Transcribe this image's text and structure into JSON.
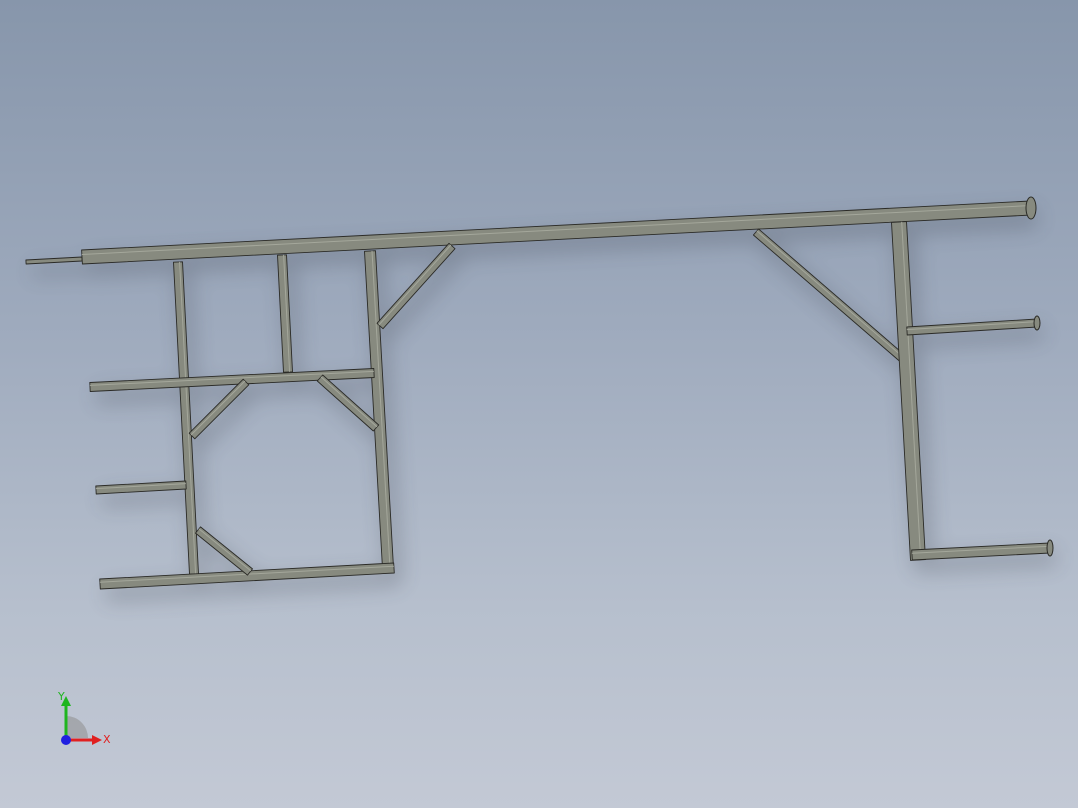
{
  "viewport": {
    "background_top": "#8796ab",
    "background_bottom": "#c3c9d5"
  },
  "model": {
    "part": "steel-tube-frame",
    "beam_color": "#878a7f",
    "beam_edge_color": "#2a2a26"
  },
  "triad": {
    "x_label": "X",
    "y_label": "Y",
    "x_color": "#e02020",
    "y_color": "#1fb51f",
    "z_color": "#2020e0"
  }
}
